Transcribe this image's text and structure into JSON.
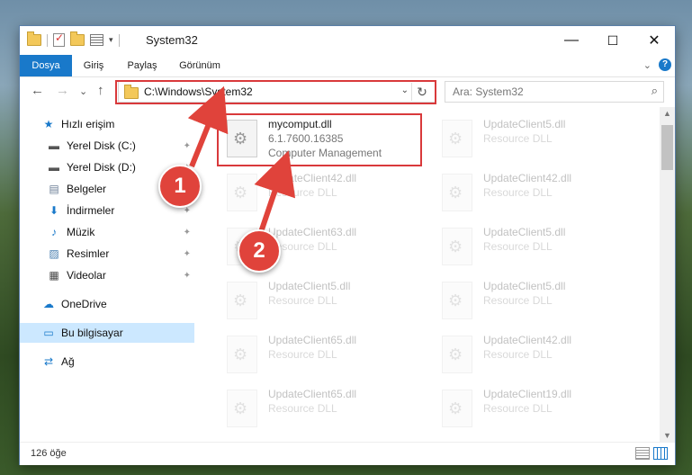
{
  "window": {
    "title": "System32",
    "minimize_glyph": "—",
    "maximize_glyph": "☐",
    "close_glyph": "✕"
  },
  "ribbon": {
    "tabs": [
      "Dosya",
      "Giriş",
      "Paylaş",
      "Görünüm"
    ],
    "accent": "#1979ca",
    "help_glyph": "?",
    "collapse_glyph": "⌄"
  },
  "navigation": {
    "back_glyph": "←",
    "forward_glyph": "→",
    "recent_glyph": "⌄",
    "up_glyph": "↑",
    "address": "C:\\Windows\\System32",
    "refresh_glyph": "↻",
    "dropdown_glyph": "⌄",
    "search_placeholder": "Ara: System32",
    "search_glyph": "⌕"
  },
  "sidebar": {
    "items": [
      {
        "label": "Hızlı erişim",
        "icon": "star-icon",
        "glyph": "★"
      },
      {
        "label": "Yerel Disk (C:)",
        "icon": "drive-icon",
        "glyph": "▬",
        "pinned": true
      },
      {
        "label": "Yerel Disk (D:)",
        "icon": "drive-icon",
        "glyph": "▬",
        "pinned": true
      },
      {
        "label": "Belgeler",
        "icon": "documents-icon",
        "glyph": "▤",
        "pinned": true
      },
      {
        "label": "İndirmeler",
        "icon": "download-icon",
        "glyph": "⬇",
        "pinned": true
      },
      {
        "label": "Müzik",
        "icon": "music-icon",
        "glyph": "♪",
        "pinned": true
      },
      {
        "label": "Resimler",
        "icon": "pictures-icon",
        "glyph": "▨",
        "pinned": true
      },
      {
        "label": "Videolar",
        "icon": "video-icon",
        "glyph": "▦",
        "pinned": true
      },
      {
        "label": "OneDrive",
        "icon": "cloud-icon",
        "glyph": "☁"
      },
      {
        "label": "Bu bilgisayar",
        "icon": "computer-icon",
        "glyph": "▭",
        "selected": true
      },
      {
        "label": "Ağ",
        "icon": "network-icon",
        "glyph": "⇄"
      }
    ],
    "pin_glyph": "📌"
  },
  "files": [
    {
      "name": "mycomput.dll",
      "version": "6.1.7600.16385",
      "description": "Computer Management",
      "highlighted": true
    },
    {
      "name": "UpdateClient5.dll",
      "description": "Resource DLL"
    },
    {
      "name": "UpdateClient42.dll",
      "description": "Resource DLL"
    },
    {
      "name": "UpdateClient42.dll",
      "description": "Resource DLL"
    },
    {
      "name": "UpdateClient63.dll",
      "description": "Resource DLL"
    },
    {
      "name": "UpdateClient5.dll",
      "description": "Resource DLL"
    },
    {
      "name": "UpdateClient5.dll",
      "description": "Resource DLL"
    },
    {
      "name": "UpdateClient5.dll",
      "description": "Resource DLL"
    },
    {
      "name": "UpdateClient65.dll",
      "description": "Resource DLL"
    },
    {
      "name": "UpdateClient42.dll",
      "description": "Resource DLL"
    },
    {
      "name": "UpdateClient65.dll",
      "description": "Resource DLL"
    },
    {
      "name": "UpdateClient19.dll",
      "description": "Resource DLL"
    }
  ],
  "status": {
    "item_count": "126 öğe"
  },
  "callouts": {
    "one": "1",
    "two": "2",
    "color": "#e0433b"
  },
  "highlight_color": "#d9393b"
}
